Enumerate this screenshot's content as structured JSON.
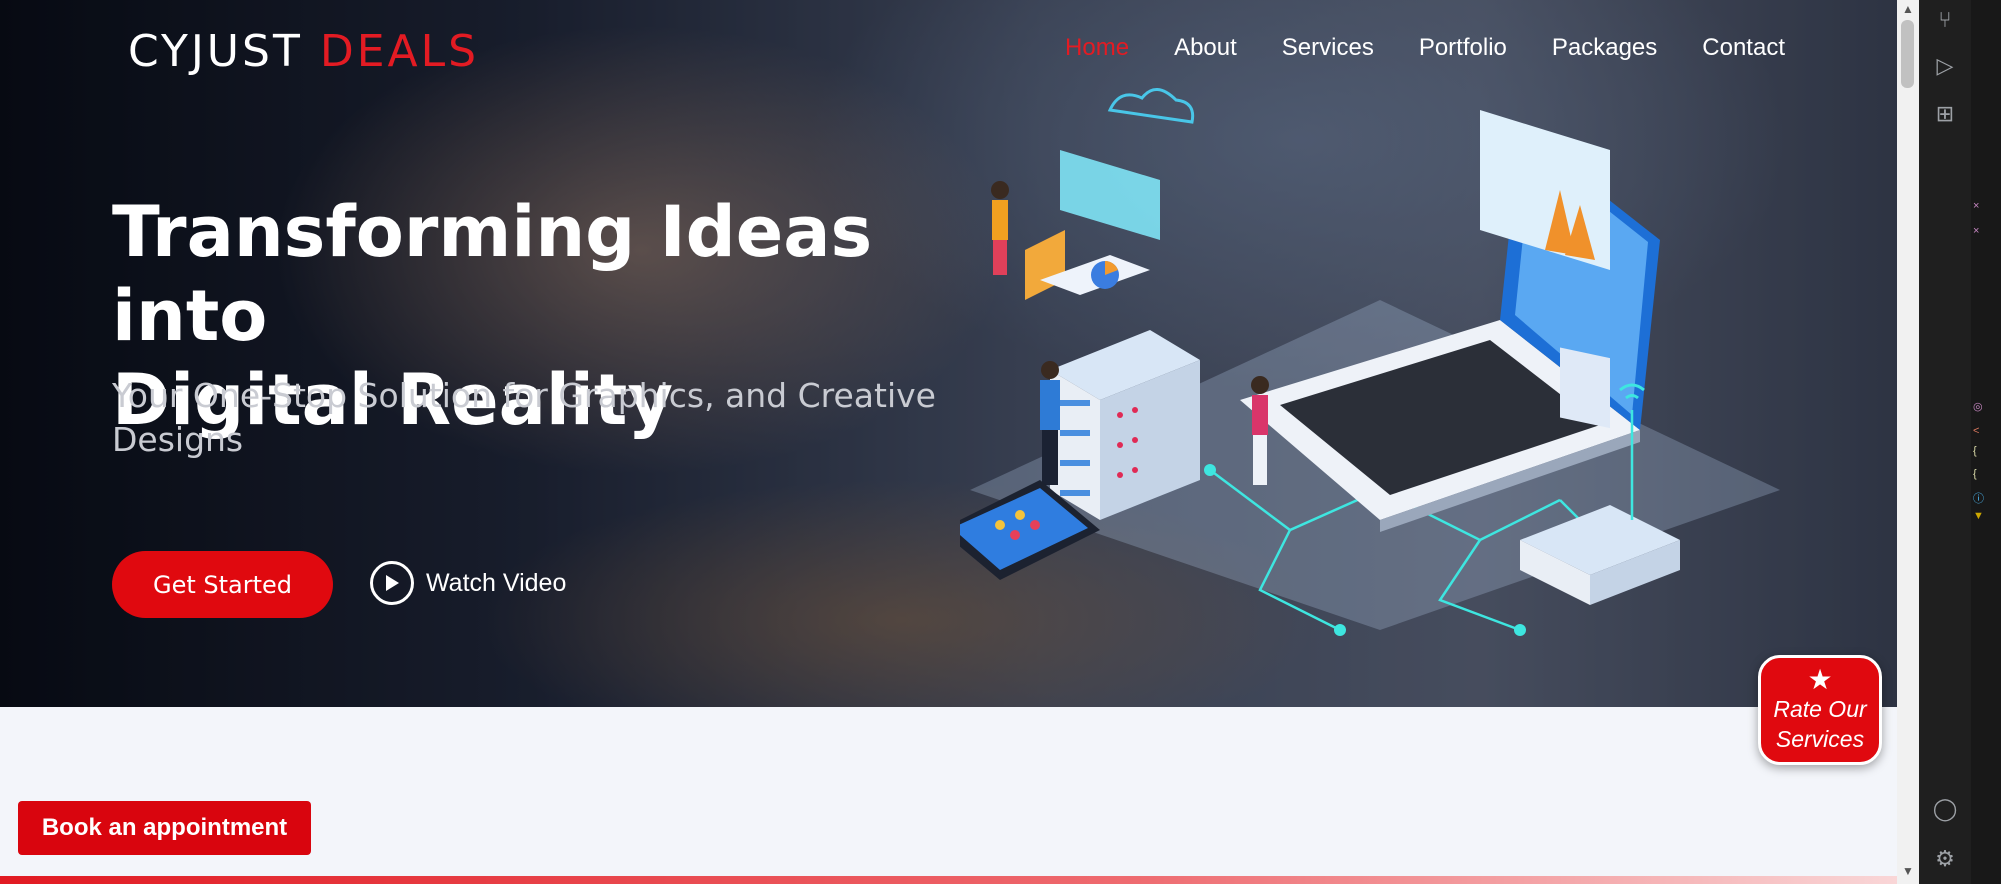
{
  "brand": {
    "name_main": "CYJUST",
    "name_accent": "DEALS"
  },
  "nav": {
    "items": [
      "Home",
      "About",
      "Services",
      "Portfolio",
      "Packages",
      "Contact"
    ],
    "active": "Home"
  },
  "hero": {
    "title_line1": "Transforming Ideas into",
    "title_line2": "Digital Reality",
    "subtitle": "Your One-Stop Solution for Graphics, and Creative Designs",
    "primary_button": "Get Started",
    "video_link": "Watch Video"
  },
  "rate_badge": {
    "line1": "Rate Our",
    "line2": "Services",
    "icon": "star-icon"
  },
  "appointment_button": "Book an appointment",
  "colors": {
    "accent": "#e0090f",
    "page_bg": "#f3f5fa",
    "ide_bg": "#1f1f1f"
  },
  "ide_sidebar": {
    "icons": [
      "source-control-icon",
      "run-debug-icon",
      "extensions-icon",
      "account-icon",
      "settings-gear-icon"
    ]
  }
}
